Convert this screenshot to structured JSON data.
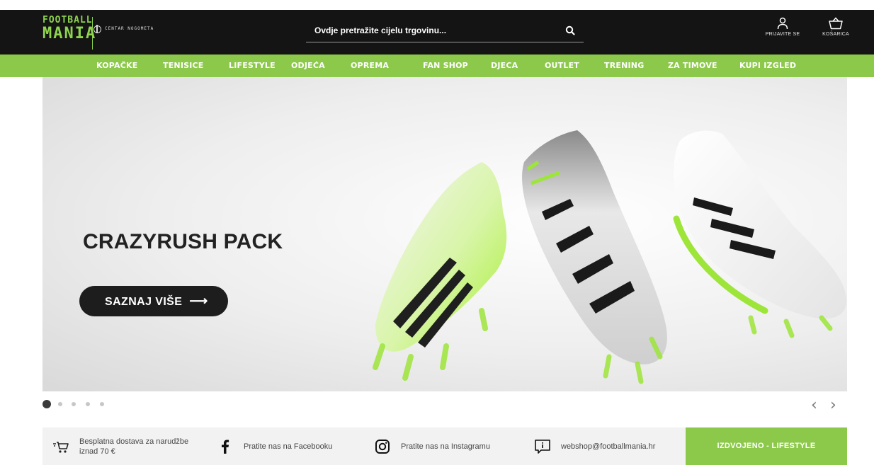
{
  "header": {
    "logo_line1": "FOOTBALL",
    "logo_line2": "MANIA",
    "logo_sub": "CENTAR NOGOMETA",
    "search_placeholder": "Ovdje pretražite cijelu trgovinu...",
    "login_label": "PRIJAVITE SE",
    "cart_label": "KOŠARICA"
  },
  "nav": {
    "items": [
      "KOPAČKE",
      "TENISICE",
      "LIFESTYLE",
      "ODJEĆA",
      "OPREMA",
      "FAN SHOP",
      "DJECA",
      "OUTLET",
      "TRENING",
      "ZA TIMOVE",
      "KUPI IZGLED"
    ]
  },
  "hero": {
    "title": "CRAZYRUSH PACK",
    "button_label": "SAZNAJ VIŠE",
    "button_arrow": "⟶"
  },
  "carousel": {
    "slide_count": 5,
    "active_slide": 1,
    "prev": "‹",
    "next": "›"
  },
  "info_bar": {
    "delivery_line1": "Besplatna dostava za narudžbe",
    "delivery_line2": "iznad 70 €",
    "facebook": "Pratite nas na Facebooku",
    "instagram": "Pratite nas na Instagramu",
    "email": "webshop@footballmania.hr",
    "featured": "IZDVOJENO - LIFESTYLE"
  },
  "colors": {
    "accent_green": "#8cc94a",
    "header_black": "#141414"
  }
}
